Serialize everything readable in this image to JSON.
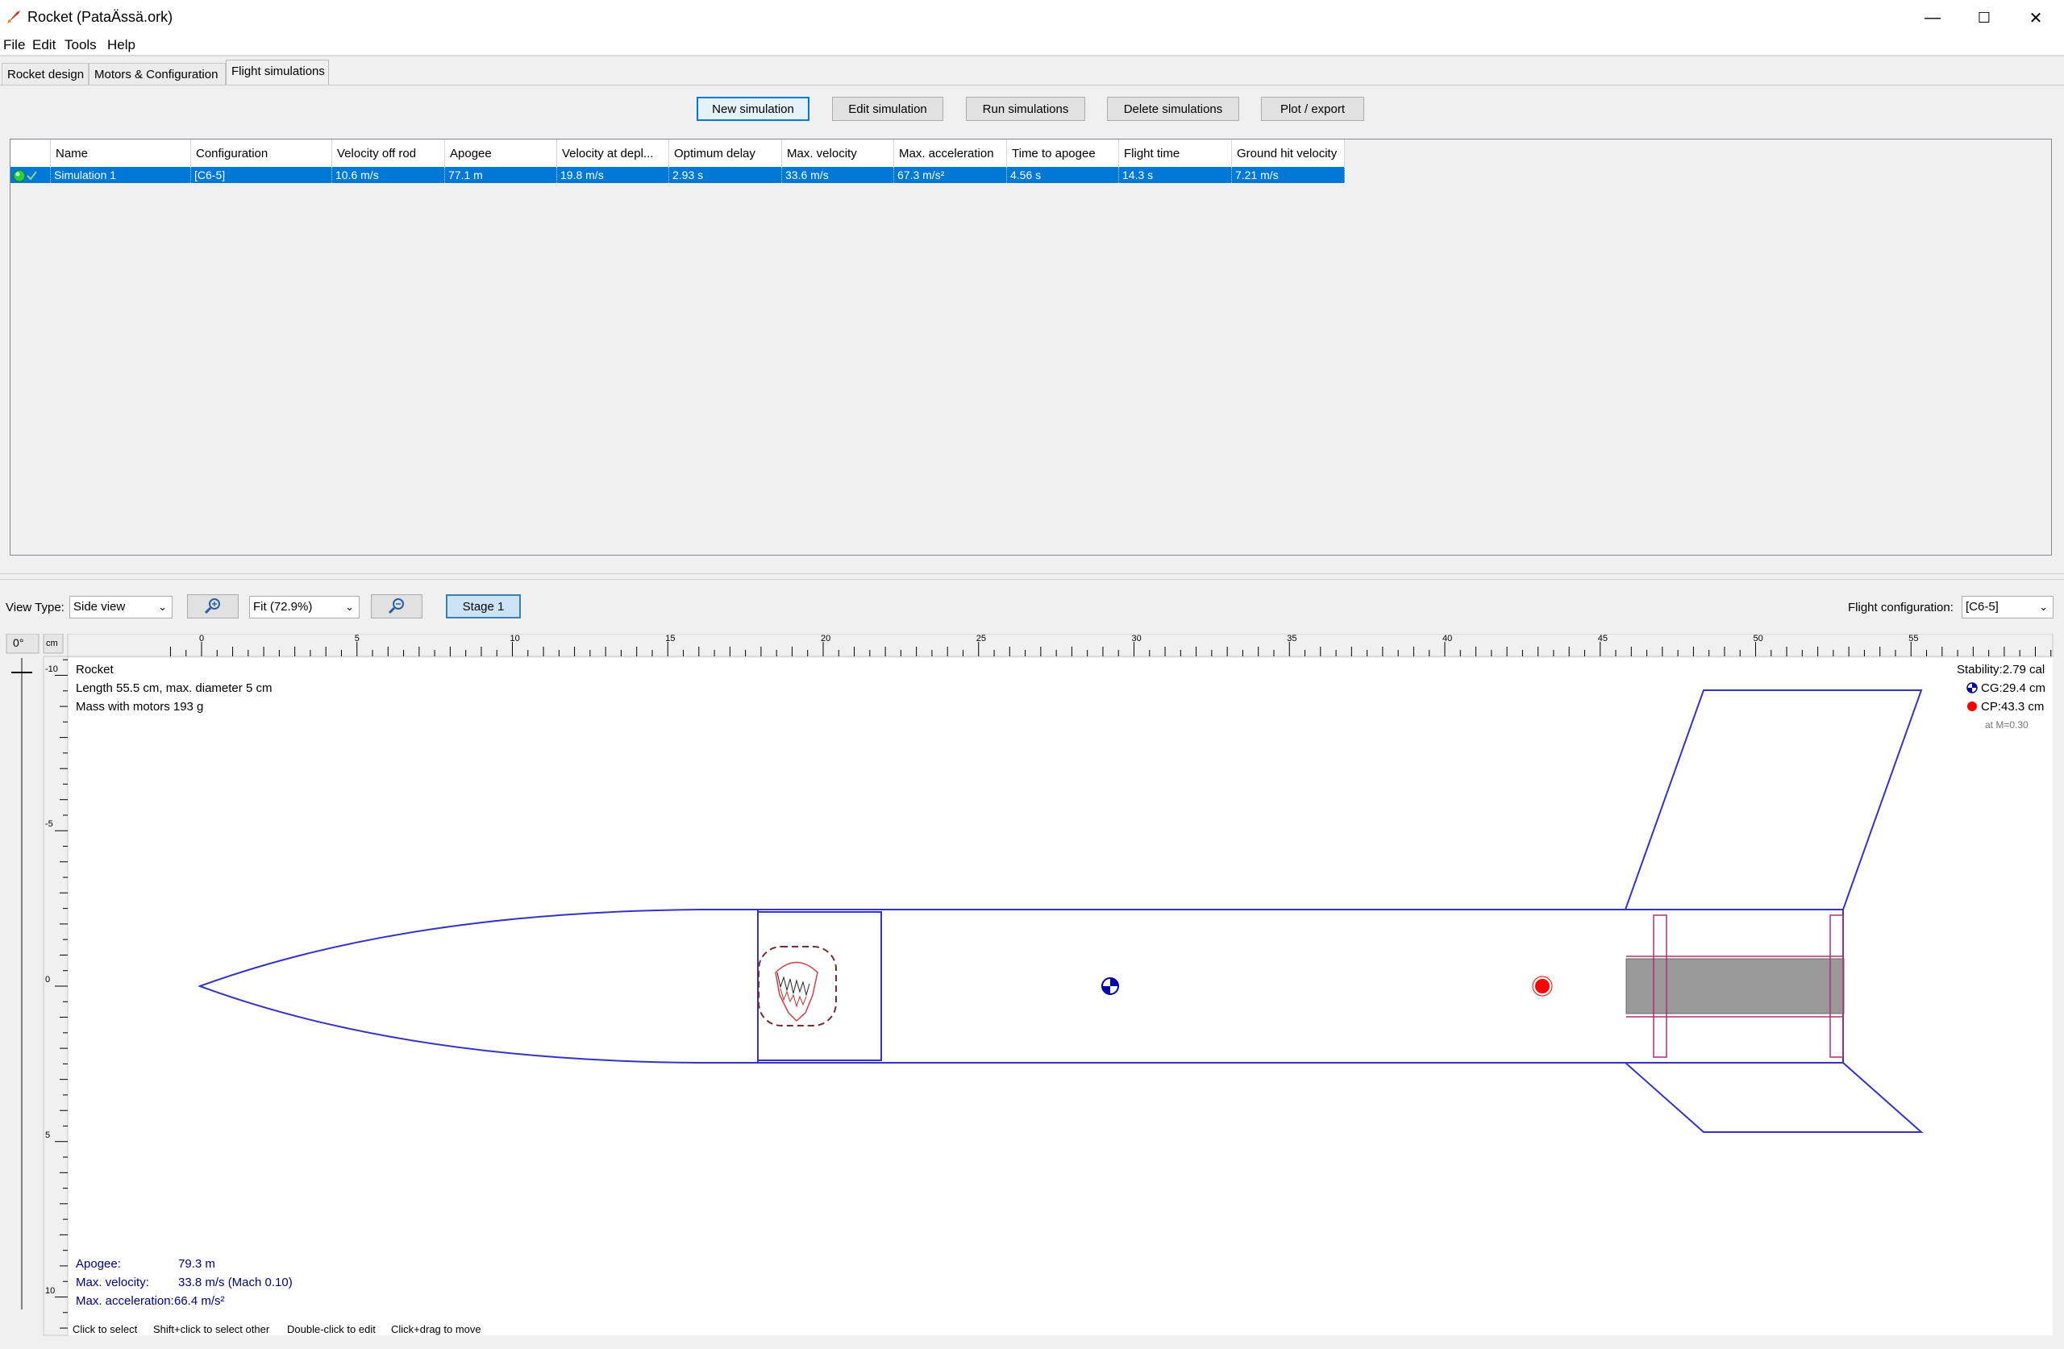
{
  "window": {
    "title": "Rocket (PataÄssä.ork)",
    "controls": {
      "minimize": "—",
      "maximize": "☐",
      "close": "✕"
    }
  },
  "menu": [
    "File",
    "Edit",
    "Tools",
    "Help"
  ],
  "tabs": [
    "Rocket design",
    "Motors & Configuration",
    "Flight simulations"
  ],
  "toolbar": {
    "new_simulation": "New simulation",
    "edit_simulation": "Edit simulation",
    "run_simulations": "Run simulations",
    "delete_simulations": "Delete simulations",
    "plot_export": "Plot / export"
  },
  "table": {
    "headers": [
      "",
      "Name",
      "Configuration",
      "Velocity off rod",
      "Apogee",
      "Velocity at depl...",
      "Optimum delay",
      "Max. velocity",
      "Max. acceleration",
      "Time to apogee",
      "Flight time",
      "Ground hit velocity"
    ],
    "rows": [
      [
        "",
        "Simulation 1",
        "[C6-5]",
        "10.6 m/s",
        "77.1 m",
        "19.8 m/s",
        "2.93 s",
        "33.6 m/s",
        "67.3 m/s²",
        "4.56 s",
        "14.3 s",
        "7.21 m/s"
      ]
    ]
  },
  "view": {
    "view_type_label": "View Type:",
    "view_type_value": "Side view",
    "zoom_value": "Fit (72.9%)",
    "stage_button": "Stage 1",
    "flight_config_label": "Flight configuration:",
    "flight_config_value": "[C6-5]"
  },
  "figure": {
    "angle": "0°",
    "unit": "cm",
    "ruler_labels": [
      "0",
      "5",
      "10",
      "15",
      "20",
      "25",
      "30",
      "35",
      "40",
      "45",
      "50",
      "55"
    ],
    "vruler_labels": [
      "-10",
      "-5",
      "0",
      "5",
      "10"
    ],
    "info_name": "Rocket",
    "info_length": "Length 55.5 cm, max. diameter 5 cm",
    "info_mass": "Mass with motors 193 g",
    "stability": "Stability:2.79 cal",
    "cg": "CG:29.4 cm",
    "cp": "CP:43.3 cm",
    "mach": "at M=0.30",
    "results": {
      "apogee_label": "Apogee:",
      "apogee_value": "79.3 m",
      "maxvel_label": "Max. velocity:",
      "maxvel_value": "33.8 m/s  (Mach 0.10)",
      "maxacc_label": "Max. acceleration:",
      "maxacc_value": "66.4 m/s²"
    }
  },
  "status": {
    "hint1": "Click to select",
    "hint2": "Shift+click to select other",
    "hint3": "Double-click to edit",
    "hint4": "Click+drag to move"
  },
  "colors": {
    "selection": "#0078d7",
    "rocket_outline": "#3333cc",
    "cp_marker": "#ff0000",
    "motor_fill": "#999999"
  }
}
